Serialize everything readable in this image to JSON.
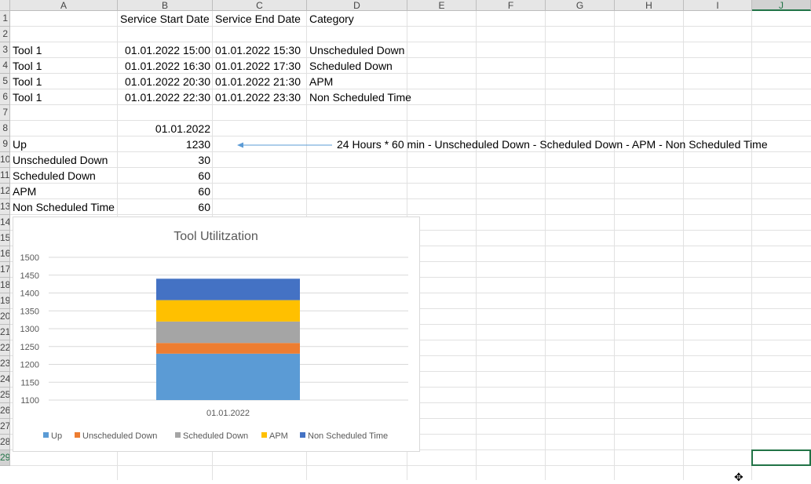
{
  "columns": [
    "A",
    "B",
    "C",
    "D",
    "E",
    "F",
    "G",
    "H",
    "I",
    "J"
  ],
  "rows": [
    "1",
    "2",
    "3",
    "4",
    "5",
    "6",
    "7",
    "8",
    "9",
    "10",
    "11",
    "12",
    "13",
    "14",
    "15",
    "16",
    "17",
    "18",
    "19",
    "20",
    "21",
    "22",
    "23",
    "24",
    "25",
    "26",
    "27",
    "28",
    "29"
  ],
  "cells": {
    "header_start": "Service Start Date",
    "header_end": "Service End Date",
    "header_category": "Category",
    "records": [
      {
        "tool": "Tool 1",
        "start": "01.01.2022 15:00",
        "end": "01.01.2022 15:30",
        "category": "Unscheduled Down"
      },
      {
        "tool": "Tool 1",
        "start": "01.01.2022 16:30",
        "end": "01.01.2022 17:30",
        "category": "Scheduled Down"
      },
      {
        "tool": "Tool 1",
        "start": "01.01.2022 20:30",
        "end": "01.01.2022 21:30",
        "category": "APM"
      },
      {
        "tool": "Tool 1",
        "start": "01.01.2022 22:30",
        "end": "01.01.2022 23:30",
        "category": "Non Scheduled Time"
      }
    ],
    "summary_date": "01.01.2022",
    "summary": [
      {
        "label": "Up",
        "value": "1230"
      },
      {
        "label": "Unscheduled Down",
        "value": "30"
      },
      {
        "label": "Scheduled Down",
        "value": "60"
      },
      {
        "label": "APM",
        "value": "60"
      },
      {
        "label": "Non Scheduled Time",
        "value": "60"
      }
    ],
    "annotation": "24 Hours * 60 min  - Unscheduled Down - Scheduled Down - APM - Non Scheduled Time"
  },
  "colors": {
    "Up": "#5b9bd5",
    "Unscheduled Down": "#ed7d31",
    "Scheduled Down": "#a5a5a5",
    "APM": "#ffc000",
    "Non Scheduled Time": "#4472c4",
    "selection": "#217346"
  },
  "chart_data": {
    "type": "bar",
    "stacked": true,
    "title": "Tool Utilitzation",
    "categories": [
      "01.01.2022"
    ],
    "series": [
      {
        "name": "Up",
        "values": [
          1230
        ]
      },
      {
        "name": "Unscheduled Down",
        "values": [
          30
        ]
      },
      {
        "name": "Scheduled Down",
        "values": [
          60
        ]
      },
      {
        "name": "APM",
        "values": [
          60
        ]
      },
      {
        "name": "Non Scheduled Time",
        "values": [
          60
        ]
      }
    ],
    "ylim": [
      1100,
      1500
    ],
    "yticks": [
      "1100",
      "1150",
      "1200",
      "1250",
      "1300",
      "1350",
      "1400",
      "1450",
      "1500"
    ],
    "grid": true,
    "legend": "bottom"
  }
}
